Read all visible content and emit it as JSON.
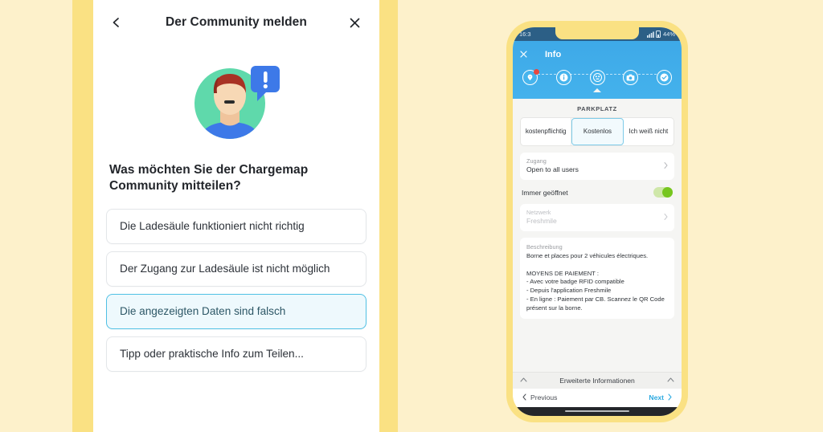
{
  "theme": {
    "page_bg": "#fdf1cb",
    "stripe": "#fae183",
    "panel_bg": "#ffffff",
    "accent_blue": "#4fc0e4",
    "phone_blue": "#44b2ec",
    "toggle_green": "#76c61e",
    "red_badge": "#e8473f"
  },
  "left_panel": {
    "header": {
      "back_icon": "chevron-left-icon",
      "title": "Der Community melden",
      "close_icon": "close-icon"
    },
    "illustration": {
      "name": "person-with-alert-bubble-illustration",
      "circle_color": "#5fd9ab",
      "shirt_color": "#3d79e8",
      "bubble_color": "#3d79e8",
      "bubble_glyph": "!",
      "hair_color": "#a83224",
      "skin_color": "#f7d8b5"
    },
    "question": "Was möchten Sie der Chargemap Community mitteilen?",
    "options": [
      {
        "label": "Die Ladesäule funktioniert nicht richtig",
        "selected": false
      },
      {
        "label": "Der Zugang zur Ladesäule ist nicht möglich",
        "selected": false
      },
      {
        "label": "Die angezeigten Daten sind falsch",
        "selected": true
      },
      {
        "label": "Tipp oder praktische Info zum Teilen...",
        "selected": false
      }
    ]
  },
  "phone": {
    "status_bar": {
      "time": "16:3",
      "battery": "44%"
    },
    "app_header": {
      "close_icon": "close-icon",
      "title": "Info",
      "steps": [
        {
          "icon": "map-pin-icon",
          "glyph": "⊙",
          "badge": true,
          "active": false
        },
        {
          "icon": "info-icon",
          "glyph": "i",
          "badge": false,
          "active": true
        },
        {
          "icon": "plug-socket-icon",
          "glyph": "⚇",
          "badge": false,
          "active": false
        },
        {
          "icon": "camera-icon",
          "glyph": "▣",
          "badge": false,
          "active": false
        },
        {
          "icon": "check-circle-icon",
          "glyph": "✓",
          "badge": false,
          "active": false
        }
      ]
    },
    "section_label": "PARKPLATZ",
    "segmented": {
      "options": [
        "kostenpflichtig",
        "Kostenlos",
        "Ich weiß nicht"
      ],
      "selected_index": 1
    },
    "access_card": {
      "label": "Zugang",
      "value": "Open to all users",
      "chevron": "chevron-right-icon"
    },
    "always_open": {
      "label": "Immer geöffnet",
      "enabled": true
    },
    "network_card": {
      "label": "Netzwerk",
      "value": "Freshmile",
      "chevron": "chevron-right-icon",
      "disabled": true
    },
    "description": {
      "label": "Beschreibung",
      "text": "Borne et places pour 2 véhicules électriques.\n\nMOYENS DE PAIEMENT :\n- Avec votre badge RFID compatible\n- Depuis l'application Freshmile\n- En ligne : Paiement par CB. Scannez le QR Code présent sur la borne."
    },
    "advanced_bar": {
      "left_chevron": "chevron-up-icon",
      "title": "Erweiterte Informationen",
      "right_chevron": "chevron-up-icon"
    },
    "nav_bar": {
      "prev_icon": "chevron-left-icon",
      "prev_label": "Previous",
      "next_label": "Next",
      "next_icon": "chevron-right-icon"
    }
  }
}
